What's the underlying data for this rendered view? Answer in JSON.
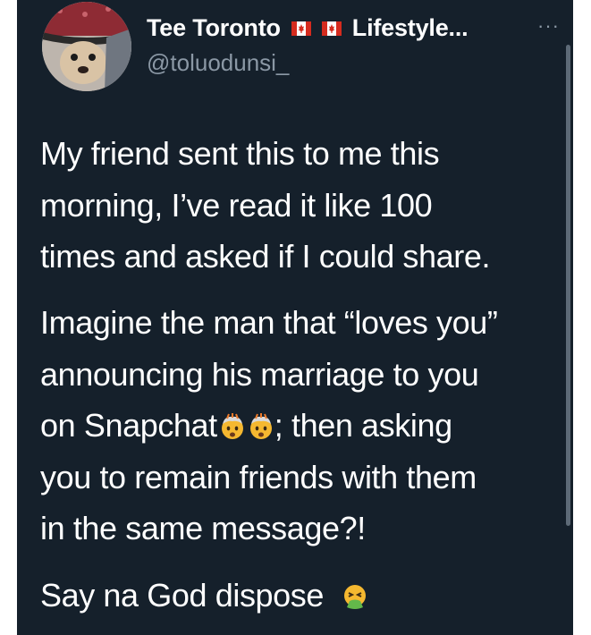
{
  "author": {
    "name": "Tee Toronto",
    "name_suffix": "Lifestyle...",
    "handle": "@toluodunsi_",
    "flag_icons": [
      "canada-flag-icon",
      "canada-flag-icon"
    ]
  },
  "more_menu_label": "···",
  "tweet": {
    "paragraph1": [
      "My friend sent this to me this",
      "morning, I’ve read it like 100",
      "times and asked if I could share."
    ],
    "paragraph2_lines": {
      "l1": "Imagine the man that “loves you”",
      "l2": "announcing his marriage to you",
      "l3_start": "on Snapchat",
      "l3_end": "; then asking",
      "l4": "you to remain friends with them",
      "l5": "in the same message?!"
    },
    "paragraph3": "Say na God dispose"
  },
  "emoji": {
    "exploding_head": "exploding-head-emoji-icon",
    "vomiting_face": "vomiting-face-emoji-icon"
  },
  "colors": {
    "background": "#15202b",
    "text": "#ffffff",
    "secondary_text": "#8b98a5",
    "page": "#ffffff"
  }
}
